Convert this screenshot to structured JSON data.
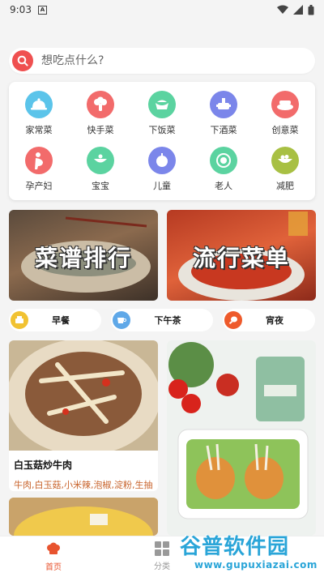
{
  "status_bar": {
    "time": "9:03"
  },
  "search": {
    "placeholder": "想吃点什么?"
  },
  "categories": [
    {
      "label": "家常菜",
      "color": "#5bc4ea",
      "icon": "cloche-icon"
    },
    {
      "label": "快手菜",
      "color": "#f26b6b",
      "icon": "broccoli-icon"
    },
    {
      "label": "下饭菜",
      "color": "#5bd3a0",
      "icon": "bowl-icon"
    },
    {
      "label": "下酒菜",
      "color": "#7b86ea",
      "icon": "hotpot-icon"
    },
    {
      "label": "创意菜",
      "color": "#f26b6b",
      "icon": "dish-icon"
    },
    {
      "label": "孕产妇",
      "color": "#f26b6b",
      "icon": "pregnant-icon"
    },
    {
      "label": "宝宝",
      "color": "#5bd3a0",
      "icon": "baby-bowl-icon"
    },
    {
      "label": "儿童",
      "color": "#7b86ea",
      "icon": "juicer-icon"
    },
    {
      "label": "老人",
      "color": "#5bd3a0",
      "icon": "noodle-icon"
    },
    {
      "label": "减肥",
      "color": "#a8c043",
      "icon": "salad-icon"
    }
  ],
  "banners": {
    "left": "菜谱排行",
    "right": "流行菜单"
  },
  "meal_chips": [
    {
      "label": "早餐",
      "color": "#f1c232"
    },
    {
      "label": "下午茶",
      "color": "#5fa8e8"
    },
    {
      "label": "宵夜",
      "color": "#ee5a2b"
    }
  ],
  "cards": {
    "left_title": "白玉菇炒牛肉",
    "left_ingredients": "牛肉,白玉菇,小米辣,泡椒,淀粉,生抽"
  },
  "tabbar": {
    "home": "首页",
    "category": "分类",
    "active_color": "#e8542f"
  },
  "watermark": {
    "line1": "谷普软件园",
    "line2": "www.gupuxiazai.com"
  }
}
